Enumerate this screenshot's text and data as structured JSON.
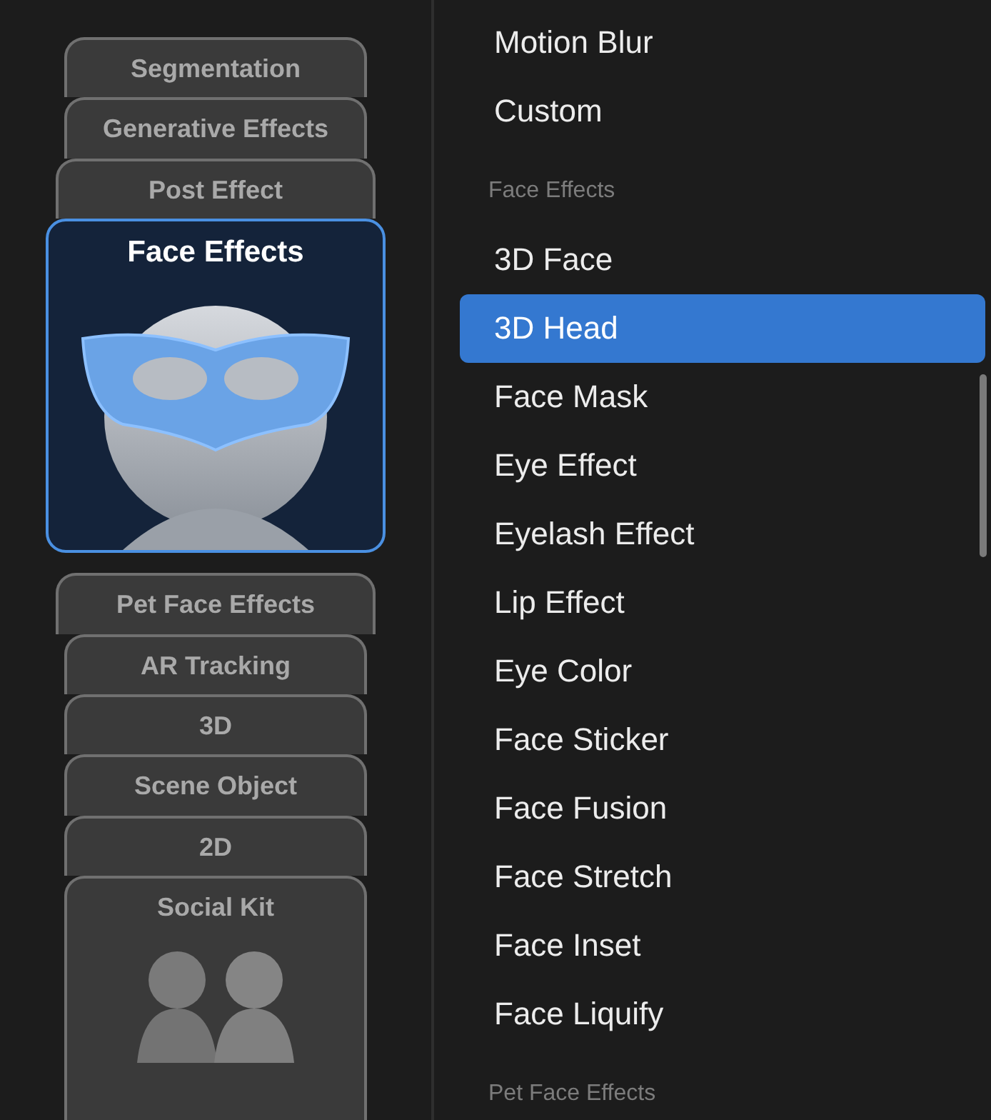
{
  "categories": [
    {
      "label": "Segmentation",
      "selected": false,
      "kind": "compact"
    },
    {
      "label": "Generative Effects",
      "selected": false,
      "kind": "compact"
    },
    {
      "label": "Post Effect",
      "selected": false,
      "kind": "compact"
    },
    {
      "label": "Face Effects",
      "selected": true,
      "kind": "full"
    },
    {
      "label": "Pet Face Effects",
      "selected": false,
      "kind": "compact"
    },
    {
      "label": "AR Tracking",
      "selected": false,
      "kind": "compact"
    },
    {
      "label": "3D",
      "selected": false,
      "kind": "compact"
    },
    {
      "label": "Scene Object",
      "selected": false,
      "kind": "compact"
    },
    {
      "label": "2D",
      "selected": false,
      "kind": "compact"
    },
    {
      "label": "Social Kit",
      "selected": false,
      "kind": "full"
    }
  ],
  "effects": [
    {
      "kind": "item",
      "label": "Motion Blur",
      "selected": false
    },
    {
      "kind": "item",
      "label": "Custom",
      "selected": false
    },
    {
      "kind": "header",
      "label": "Face Effects"
    },
    {
      "kind": "item",
      "label": "3D Face",
      "selected": false
    },
    {
      "kind": "item",
      "label": "3D Head",
      "selected": true
    },
    {
      "kind": "item",
      "label": "Face Mask",
      "selected": false
    },
    {
      "kind": "item",
      "label": "Eye Effect",
      "selected": false
    },
    {
      "kind": "item",
      "label": "Eyelash Effect",
      "selected": false
    },
    {
      "kind": "item",
      "label": "Lip Effect",
      "selected": false
    },
    {
      "kind": "item",
      "label": "Eye Color",
      "selected": false
    },
    {
      "kind": "item",
      "label": "Face Sticker",
      "selected": false
    },
    {
      "kind": "item",
      "label": "Face Fusion",
      "selected": false
    },
    {
      "kind": "item",
      "label": "Face Stretch",
      "selected": false
    },
    {
      "kind": "item",
      "label": "Face Inset",
      "selected": false
    },
    {
      "kind": "item",
      "label": "Face Liquify",
      "selected": false
    },
    {
      "kind": "header",
      "label": "Pet Face Effects"
    }
  ]
}
